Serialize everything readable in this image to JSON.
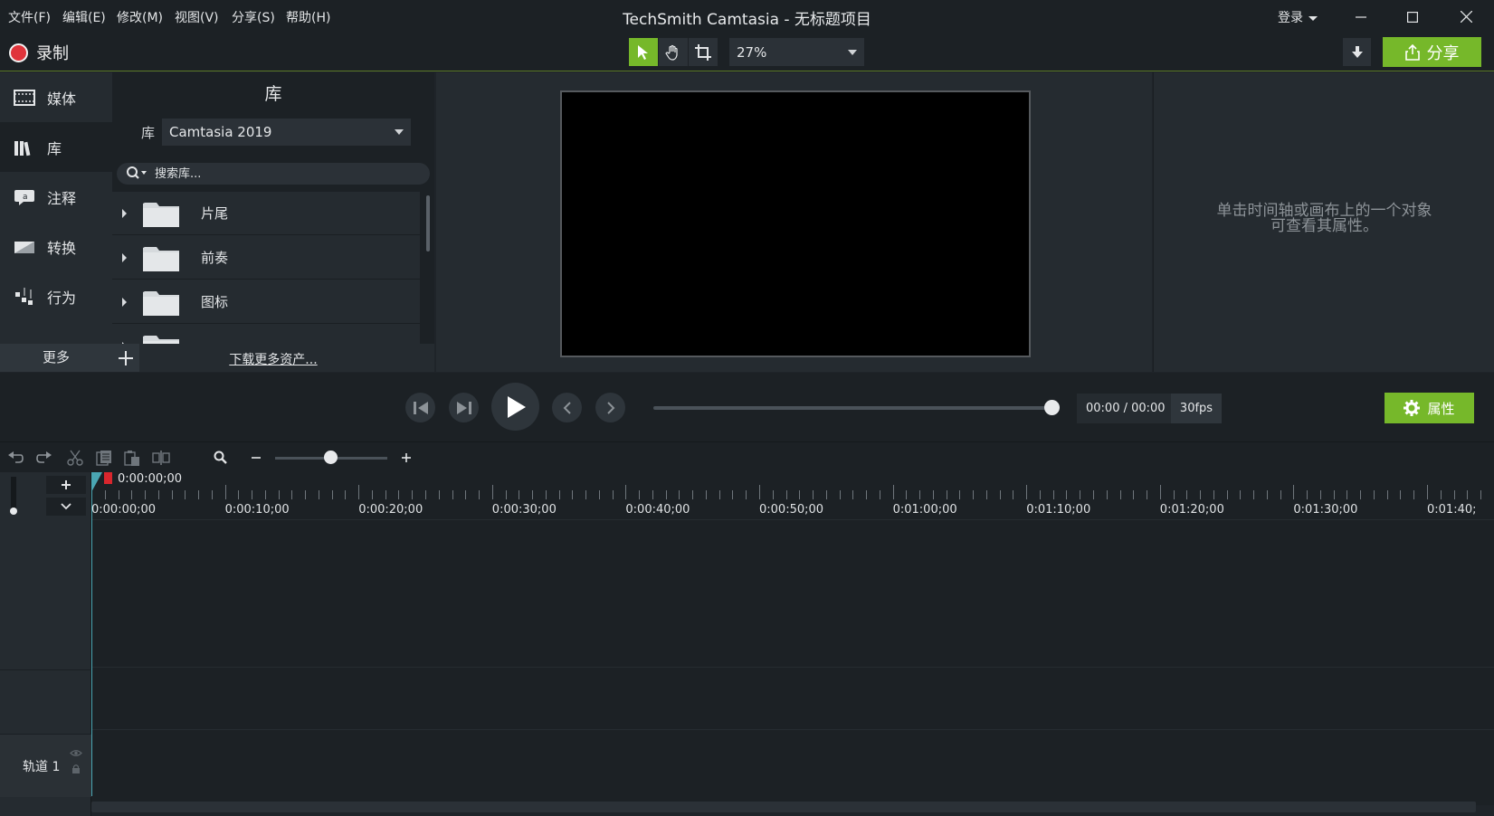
{
  "menu": {
    "items": [
      "文件(F)",
      "编辑(E)",
      "修改(M)",
      "视图(V)",
      "分享(S)",
      "帮助(H)"
    ]
  },
  "window": {
    "title": "TechSmith Camtasia - 无标题项目",
    "login_label": "登录"
  },
  "toolbar": {
    "record_label": "录制",
    "zoom_value": "27%",
    "share_label": "分享",
    "accent_color": "#76b82a"
  },
  "side_tabs": {
    "items": [
      {
        "label": "媒体",
        "icon": "film-icon"
      },
      {
        "label": "库",
        "icon": "library-icon"
      },
      {
        "label": "注释",
        "icon": "annotation-icon"
      },
      {
        "label": "转换",
        "icon": "transition-icon"
      },
      {
        "label": "行为",
        "icon": "behavior-icon"
      }
    ],
    "active": "库",
    "more_label": "更多"
  },
  "library": {
    "title": "库",
    "select_label": "库",
    "select_value": "Camtasia 2019",
    "search_placeholder": "搜索库...",
    "items": [
      "片尾",
      "前奏",
      "图标"
    ],
    "download_link": "下载更多资产..."
  },
  "properties": {
    "hint_line1": "单击时间轴或画布上的一个对象",
    "hint_line2": "可查看其属性。",
    "button_label": "属性"
  },
  "playback": {
    "time": "00:00 / 00:00",
    "fps": "30fps"
  },
  "timeline": {
    "playhead_time": "0:00:00;00",
    "ruler_labels": [
      "0:00:00;00",
      "0:00:10;00",
      "0:00:20;00",
      "0:00:30;00",
      "0:00:40;00",
      "0:00:50;00",
      "0:01:00;00",
      "0:01:10;00",
      "0:01:20;00",
      "0:01:30;00",
      "0:01:40;"
    ],
    "track_label": "轨道 1"
  }
}
